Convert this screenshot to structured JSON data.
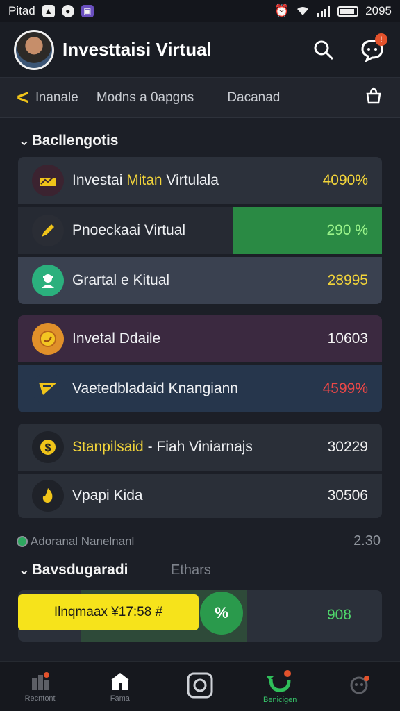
{
  "status": {
    "carrier": "Pitad",
    "time": "2095"
  },
  "header": {
    "title": "Investtaisi Virtual"
  },
  "subnav": {
    "tabs": [
      "lnanale",
      "Modns a 0apgns",
      "Dacanad"
    ]
  },
  "section1": {
    "title": "Bacllengotis",
    "rows": [
      {
        "label_a": "Investai ",
        "label_hl": "Mitan",
        "label_b": " Virtulala",
        "value": "4090%",
        "value_color": "#f2d43a",
        "icon": "chart-icon",
        "icon_bg": "#3b2330",
        "row_bg": "#2c313b"
      },
      {
        "label_a": "Pnoeckaai Virtual",
        "label_hl": "",
        "label_b": "",
        "value": "290 %",
        "value_color": "#9cf58b",
        "icon": "pencil-icon",
        "icon_bg": "#2a2d35",
        "row_bg": "#262a33",
        "progress": 0.41
      },
      {
        "label_a": "Grartal e Kitual",
        "label_hl": "",
        "label_b": "",
        "value": "28995",
        "value_color": "#f2d43a",
        "icon": "worker-icon",
        "icon_bg": "#2bb07d",
        "row_bg": "#3a4150"
      }
    ]
  },
  "section2": {
    "rows": [
      {
        "label": "Invetal Ddaile",
        "value": "10603",
        "value_color": "#f2f2f2",
        "icon": "coin-icon",
        "icon_bg": "#e0902a",
        "row_bg": "#3b2940"
      },
      {
        "label": "Vaetedbladaid Knangiann",
        "value": "4599%",
        "value_color": "#ea4747",
        "icon": "ticket-icon",
        "icon_bg": "#26364c",
        "row_bg": "#26364c"
      }
    ]
  },
  "section3": {
    "rows": [
      {
        "label_hl": "Stanpilsaid",
        "label_b": " - Fiah Viniarnajs",
        "value": "30229",
        "icon": "dollar-icon",
        "icon_bg": "#1f2229",
        "row_bg": "#2a2f38"
      },
      {
        "label_hl": "",
        "label_b": "Vpapi Kida",
        "value": "30506",
        "icon": "flame-icon",
        "icon_bg": "#1f2229",
        "row_bg": "#2a2f38"
      }
    ]
  },
  "adv": {
    "label": "Adoranal Nanelnanl",
    "value": "2.30"
  },
  "section4": {
    "title": "Bavsdugaradi",
    "alt": "Ethars"
  },
  "action": {
    "button_label": "Ilnqmaax ¥17:58 #",
    "green_symbol": "%",
    "value": "908"
  },
  "bottom_nav": [
    {
      "label": "Recntont",
      "icon": "chart-bars-icon",
      "active": false
    },
    {
      "label": "Fama",
      "icon": "home-icon",
      "active": false
    },
    {
      "label": "",
      "icon": "center-icon",
      "active": false
    },
    {
      "label": "Benicigen",
      "icon": "refresh-icon",
      "active": true
    },
    {
      "label": "",
      "icon": "support-icon",
      "active": false
    }
  ],
  "colors": {
    "accent_yellow": "#f2d43a",
    "accent_green": "#2a9a4c",
    "danger_red": "#ea4747"
  }
}
